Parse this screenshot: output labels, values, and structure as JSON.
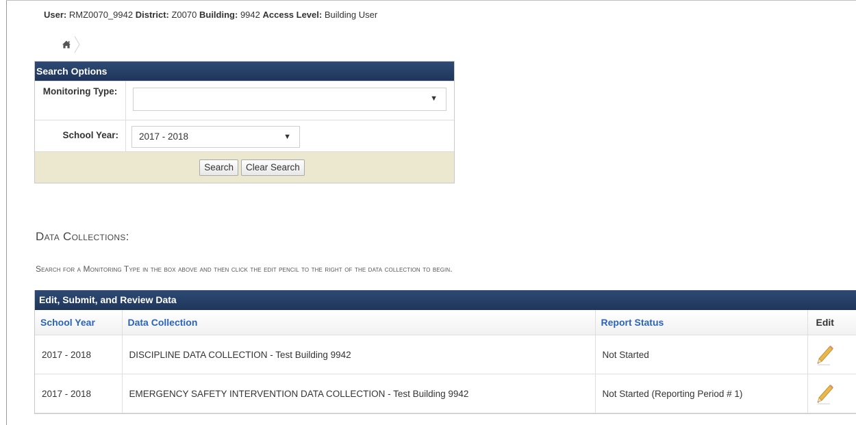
{
  "user_bar": {
    "user_label": "User:",
    "user_value": "RMZ0070_9942",
    "district_label": "District:",
    "district_value": "Z0070",
    "building_label": "Building:",
    "building_value": "9942",
    "access_label": "Access Level:",
    "access_value": "Building User"
  },
  "breadcrumb": {
    "icons": [
      "home-icon",
      "chevron-right-icon"
    ]
  },
  "search": {
    "title": "Search Options",
    "monitoring_type": {
      "label": "Monitoring Type:",
      "value": ""
    },
    "school_year": {
      "label": "School Year:",
      "value": "2017 - 2018"
    },
    "search_button": "Search",
    "clear_button": "Clear Search"
  },
  "section": {
    "title": "Data Collections:",
    "instructions": "Search for a Monitoring Type in the box above and then click the edit pencil to the right of the data collection to begin."
  },
  "table": {
    "title": "Edit, Submit, and Review Data",
    "columns": [
      "School Year",
      "Data Collection",
      "Report Status",
      "Edit"
    ],
    "rows": [
      {
        "school_year": "2017 - 2018",
        "data_collection": "DISCIPLINE DATA COLLECTION - Test Building 9942",
        "report_status": "Not Started",
        "edit_icon": "pencil-icon"
      },
      {
        "school_year": "2017 - 2018",
        "data_collection": "EMERGENCY SAFETY INTERVENTION DATA COLLECTION - Test Building 9942",
        "report_status": "Not Started (Reporting Period # 1)",
        "edit_icon": "pencil-icon"
      }
    ]
  },
  "colors": {
    "panel_header": "#1f365a",
    "column_header_link": "#2a64b8",
    "button_bar": "#ece7cf"
  }
}
